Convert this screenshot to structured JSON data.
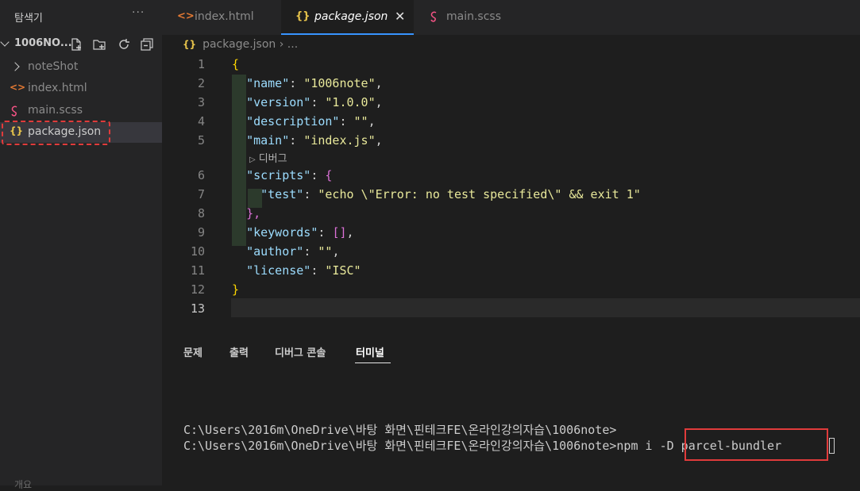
{
  "sidebar": {
    "title": "탐색기",
    "more": "···",
    "folder": "1006NO...",
    "items": [
      {
        "label": "noteShot",
        "type": "folder"
      },
      {
        "label": "index.html",
        "icon": "<>",
        "icon_color": "#e37933"
      },
      {
        "label": "main.scss",
        "icon": "sass",
        "icon_color": "#f55385"
      },
      {
        "label": "package.json",
        "icon": "{}",
        "icon_color": "#e6c34b"
      }
    ],
    "bottom": "개요"
  },
  "tabs": [
    {
      "label": "index.html",
      "icon": "<>",
      "icon_color": "#e37933"
    },
    {
      "label": "package.json",
      "icon": "{}",
      "icon_color": "#e6c34b",
      "active": true,
      "close": "✕"
    },
    {
      "label": "main.scss",
      "icon": "sass",
      "icon_color": "#f55385"
    }
  ],
  "breadcrumb": {
    "icon": "{}",
    "file": "package.json",
    "sep": "›",
    "rest": "..."
  },
  "editor": {
    "line_numbers": [
      "1",
      "2",
      "3",
      "4",
      "5",
      "6",
      "7",
      "8",
      "9",
      "10",
      "11",
      "12",
      "13"
    ],
    "codelens": "디버그",
    "lines": {
      "l1": "{",
      "l2_key": "\"name\"",
      "l2_val": "\"1006note\"",
      "l3_key": "\"version\"",
      "l3_val": "\"1.0.0\"",
      "l4_key": "\"description\"",
      "l4_val": "\"\"",
      "l5_key": "\"main\"",
      "l5_val": "\"index.js\"",
      "l6_key": "\"scripts\"",
      "l6_val": "{",
      "l7_key": "\"test\"",
      "l7_val": "\"echo \\\"Error: no test specified\\\" && exit 1\"",
      "l8": "},",
      "l9_key": "\"keywords\"",
      "l9_val": "[]",
      "l10_key": "\"author\"",
      "l10_val": "\"\"",
      "l11_key": "\"license\"",
      "l11_val": "\"ISC\"",
      "l12": "}"
    }
  },
  "panel": {
    "tabs": [
      "문제",
      "출력",
      "디버그 콘솔",
      "터미널"
    ],
    "active_tab": "터미널"
  },
  "terminal": {
    "line1": "C:\\Users\\2016m\\OneDrive\\바탕 화면\\핀테크FE\\온라인강의자습\\1006note>",
    "line2_prompt": "C:\\Users\\2016m\\OneDrive\\바탕 화면\\핀테크FE\\온라인강의자습\\1006note>npm",
    "line2_cmd": " i -D parcel-bundler"
  }
}
